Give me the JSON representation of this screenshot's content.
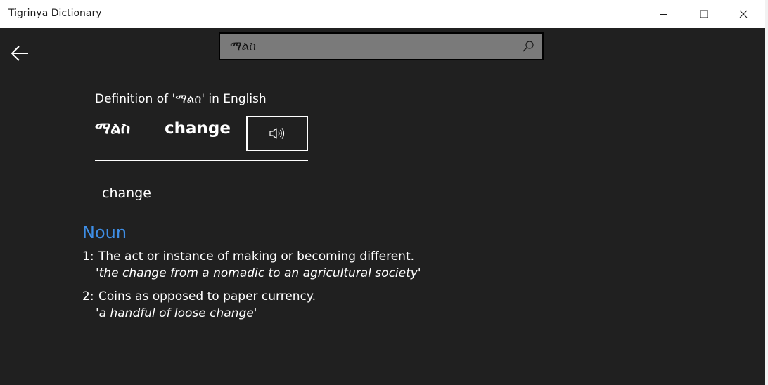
{
  "app": {
    "title": "Tigrinya Dictionary"
  },
  "window_controls": {
    "minimize_icon": "minimize-icon",
    "maximize_icon": "maximize-icon",
    "close_icon": "close-icon"
  },
  "nav": {
    "back_icon": "back-arrow-icon"
  },
  "search": {
    "value": "ማልስ",
    "icon": "search-icon"
  },
  "entry": {
    "heading": "Definition of 'ማልስ' in English",
    "word_tigrinya": "ማልስ",
    "word_english": "change",
    "speaker_icon": "speaker-icon",
    "translation": "change"
  },
  "definitions": {
    "part_of_speech": "Noun",
    "senses": [
      {
        "number": "1:",
        "definition": "The act or instance of making or becoming different.",
        "example": "'the change from a nomadic to an agricultural society'"
      },
      {
        "number": "2:",
        "definition": "Coins as opposed to paper currency.",
        "example": "'a handful of loose change'"
      }
    ]
  },
  "colors": {
    "background": "#202020",
    "titlebar": "#ffffff",
    "accent": "#3e8ee6",
    "search_bg": "#7a7a7a",
    "text": "#ffffff"
  }
}
